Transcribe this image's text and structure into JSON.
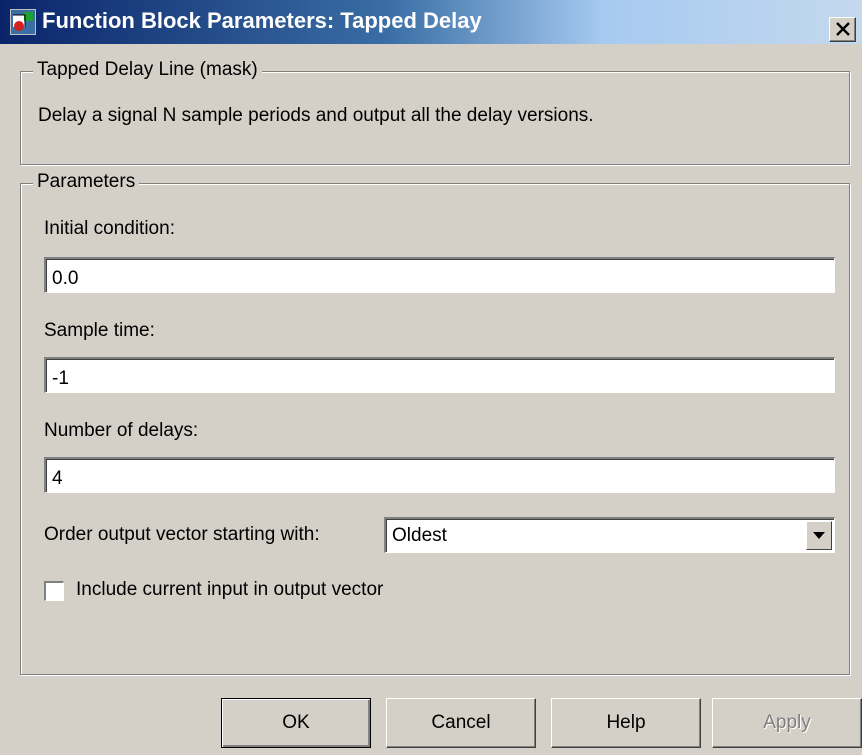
{
  "window": {
    "title": "Function Block Parameters: Tapped Delay",
    "close_label": "X"
  },
  "mask_group": {
    "legend": "Tapped Delay Line (mask)",
    "description": "Delay a signal N sample periods and output all the delay versions."
  },
  "params_group": {
    "legend": "Parameters",
    "initial_condition": {
      "label": "Initial condition:",
      "value": "0.0"
    },
    "sample_time": {
      "label": "Sample time:",
      "value": "-1"
    },
    "number_of_delays": {
      "label": "Number of delays:",
      "value": "4"
    },
    "order_output": {
      "label": "Order output vector starting with:",
      "selected": "Oldest"
    },
    "include_current": {
      "label": "Include current input in output vector",
      "checked": false
    }
  },
  "buttons": {
    "ok": "OK",
    "cancel": "Cancel",
    "help": "Help",
    "apply": "Apply"
  },
  "icons": {
    "app": "simulink-block-icon",
    "close": "close-icon",
    "dropdown": "chevron-down-icon"
  }
}
